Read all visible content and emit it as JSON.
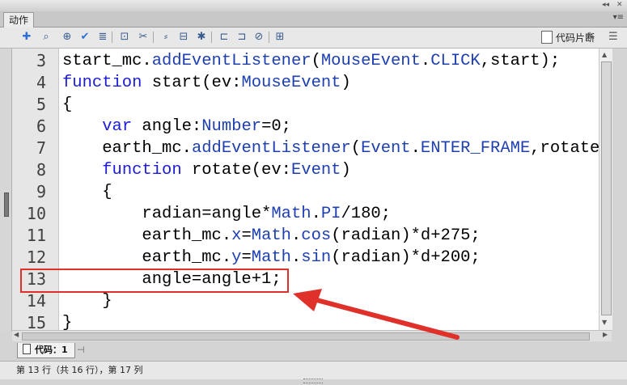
{
  "window": {
    "title_controls": {
      "collapse": "◂◂",
      "close": "✕"
    },
    "panel_tab": "动作",
    "panel_menu": "▾≡"
  },
  "toolbar": {
    "icons": [
      "add-statement-icon",
      "find-icon",
      "insert-target-path-icon",
      "check-syntax-icon",
      "auto-format-icon",
      "show-code-hint-icon",
      "debug-options-icon",
      "collapse-between-braces-icon",
      "collapse-selection-icon",
      "expand-all-icon",
      "apply-block-comment-icon",
      "apply-line-comment-icon",
      "remove-comment-icon",
      "show-hide-toolbox-icon"
    ],
    "code_snippets_label": "代码片断",
    "wand_icon": "wand-icon",
    "panel_menu_icon": "panel-menu-icon"
  },
  "editor": {
    "lines": [
      {
        "num": "3",
        "tokens": [
          {
            "t": "start_mc.",
            "c": ""
          },
          {
            "t": "addEventListener",
            "c": "ty"
          },
          {
            "t": "(",
            "c": ""
          },
          {
            "t": "MouseEvent",
            "c": "ty"
          },
          {
            "t": ".",
            "c": ""
          },
          {
            "t": "CLICK",
            "c": "ty"
          },
          {
            "t": ",start);",
            "c": ""
          }
        ]
      },
      {
        "num": "4",
        "tokens": [
          {
            "t": "function",
            "c": "kw"
          },
          {
            "t": " start(ev:",
            "c": ""
          },
          {
            "t": "MouseEvent",
            "c": "ty"
          },
          {
            "t": ")",
            "c": ""
          }
        ]
      },
      {
        "num": "5",
        "tokens": [
          {
            "t": "{",
            "c": ""
          }
        ]
      },
      {
        "num": "6",
        "tokens": [
          {
            "t": "    ",
            "c": ""
          },
          {
            "t": "var",
            "c": "kw"
          },
          {
            "t": " angle:",
            "c": ""
          },
          {
            "t": "Number",
            "c": "ty"
          },
          {
            "t": "=0;",
            "c": ""
          }
        ]
      },
      {
        "num": "7",
        "tokens": [
          {
            "t": "    earth_mc.",
            "c": ""
          },
          {
            "t": "addEventListener",
            "c": "ty"
          },
          {
            "t": "(",
            "c": ""
          },
          {
            "t": "Event",
            "c": "ty"
          },
          {
            "t": ".",
            "c": ""
          },
          {
            "t": "ENTER_FRAME",
            "c": "ty"
          },
          {
            "t": ",rotate);",
            "c": ""
          }
        ]
      },
      {
        "num": "8",
        "tokens": [
          {
            "t": "    ",
            "c": ""
          },
          {
            "t": "function",
            "c": "kw"
          },
          {
            "t": " rotate(ev:",
            "c": ""
          },
          {
            "t": "Event",
            "c": "ty"
          },
          {
            "t": ")",
            "c": ""
          }
        ]
      },
      {
        "num": "9",
        "tokens": [
          {
            "t": "    {",
            "c": ""
          }
        ]
      },
      {
        "num": "10",
        "tokens": [
          {
            "t": "        radian=angle*",
            "c": ""
          },
          {
            "t": "Math",
            "c": "ty"
          },
          {
            "t": ".",
            "c": ""
          },
          {
            "t": "PI",
            "c": "ty"
          },
          {
            "t": "/180;",
            "c": ""
          }
        ]
      },
      {
        "num": "11",
        "tokens": [
          {
            "t": "        earth_mc.",
            "c": ""
          },
          {
            "t": "x",
            "c": "ty"
          },
          {
            "t": "=",
            "c": ""
          },
          {
            "t": "Math",
            "c": "ty"
          },
          {
            "t": ".",
            "c": ""
          },
          {
            "t": "cos",
            "c": "ty"
          },
          {
            "t": "(radian)*d+275;",
            "c": ""
          }
        ]
      },
      {
        "num": "12",
        "tokens": [
          {
            "t": "        earth_mc.",
            "c": ""
          },
          {
            "t": "y",
            "c": "ty"
          },
          {
            "t": "=",
            "c": ""
          },
          {
            "t": "Math",
            "c": "ty"
          },
          {
            "t": ".",
            "c": ""
          },
          {
            "t": "sin",
            "c": "ty"
          },
          {
            "t": "(radian)*d+200;",
            "c": ""
          }
        ]
      },
      {
        "num": "13",
        "tokens": [
          {
            "t": "        angle=angle+1;",
            "c": ""
          }
        ]
      },
      {
        "num": "14",
        "tokens": [
          {
            "t": "    }",
            "c": ""
          }
        ]
      },
      {
        "num": "15",
        "tokens": [
          {
            "t": "}",
            "c": ""
          }
        ]
      }
    ],
    "highlighted_line": "13"
  },
  "bottom_tab": {
    "label": "代码：1"
  },
  "status": {
    "text": "第 13 行（共 16 行），第 17 列"
  },
  "colors": {
    "keyword": "#1c1cd8",
    "type": "#1e3fb0",
    "highlight": "#e0302a"
  }
}
